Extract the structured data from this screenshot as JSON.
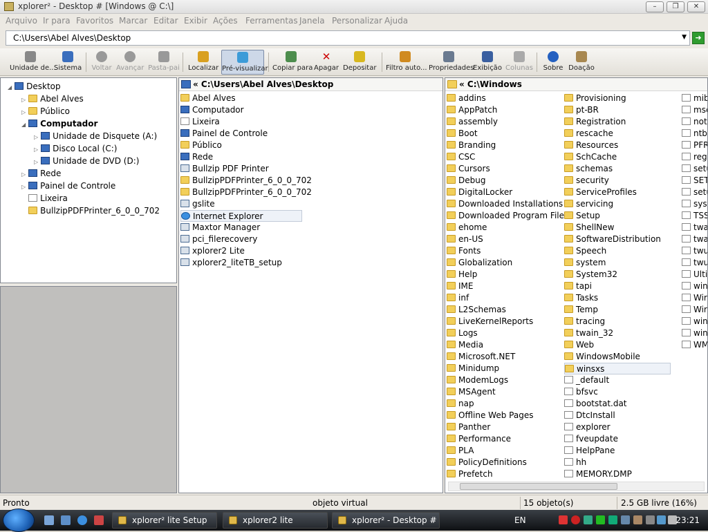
{
  "window": {
    "title": "xplorer² - Desktop # [Windows @ C:\\]"
  },
  "menu": [
    "Arquivo",
    "Ir para",
    "Favoritos",
    "Marcar",
    "Editar",
    "Exibir",
    "Ações",
    "Ferramentas",
    "Janela",
    "Personalizar",
    "Ajuda"
  ],
  "address": {
    "value": "C:\\Users\\Abel Alves\\Desktop"
  },
  "toolbar": [
    {
      "label": "Unidade de...",
      "icon": "drive-icon",
      "enabled": true
    },
    {
      "label": "Sistema",
      "icon": "system-icon",
      "enabled": true
    },
    {
      "label": "Voltar",
      "icon": "back-icon",
      "enabled": false
    },
    {
      "label": "Avançar",
      "icon": "forward-icon",
      "enabled": false
    },
    {
      "label": "Pasta-pai",
      "icon": "parent-folder-icon",
      "enabled": false
    },
    {
      "label": "Localizar",
      "icon": "binoculars-icon",
      "enabled": true
    },
    {
      "label": "Pré-visualizar",
      "icon": "preview-icon",
      "enabled": true,
      "pressed": true
    },
    {
      "label": "Copiar para",
      "icon": "copy-icon",
      "enabled": true
    },
    {
      "label": "Apagar",
      "icon": "delete-icon",
      "enabled": true
    },
    {
      "label": "Depositar",
      "icon": "deposit-icon",
      "enabled": true
    },
    {
      "label": "Filtro auto...",
      "icon": "filter-icon",
      "enabled": true
    },
    {
      "label": "Propriedades",
      "icon": "properties-icon",
      "enabled": true
    },
    {
      "label": "Exibição",
      "icon": "view-icon",
      "enabled": true
    },
    {
      "label": "Colunas",
      "icon": "columns-icon",
      "enabled": false
    },
    {
      "label": "Sobre",
      "icon": "help-icon",
      "enabled": true
    },
    {
      "label": "Doação",
      "icon": "donate-icon",
      "enabled": true
    }
  ],
  "tree": [
    {
      "label": "Desktop",
      "level": 0,
      "icon": "desktop-icon"
    },
    {
      "label": "Abel Alves",
      "level": 1,
      "icon": "user-folder-icon"
    },
    {
      "label": "Público",
      "level": 1,
      "icon": "folder-icon"
    },
    {
      "label": "Computador",
      "level": 1,
      "icon": "computer-icon",
      "bold": true
    },
    {
      "label": "Unidade de Disquete (A:)",
      "level": 2,
      "icon": "floppy-icon"
    },
    {
      "label": "Disco Local (C:)",
      "level": 2,
      "icon": "disk-icon"
    },
    {
      "label": "Unidade de DVD (D:)",
      "level": 2,
      "icon": "dvd-icon"
    },
    {
      "label": "Rede",
      "level": 1,
      "icon": "network-icon"
    },
    {
      "label": "Painel de Controle",
      "level": 1,
      "icon": "control-panel-icon"
    },
    {
      "label": "Lixeira",
      "level": 1,
      "icon": "recycle-bin-icon"
    },
    {
      "label": "BullzipPDFPrinter_6_0_0_702",
      "level": 1,
      "icon": "folder-icon"
    }
  ],
  "left_pane": {
    "header": "« C:\\Users\\Abel Alves\\Desktop",
    "items": [
      {
        "name": "Abel Alves",
        "icon": "user-folder-icon"
      },
      {
        "name": "Computador",
        "icon": "computer-icon"
      },
      {
        "name": "Lixeira",
        "icon": "recycle-bin-icon"
      },
      {
        "name": "Painel de Controle",
        "icon": "control-panel-icon"
      },
      {
        "name": "Público",
        "icon": "folder-icon"
      },
      {
        "name": "Rede",
        "icon": "network-icon"
      },
      {
        "name": "Bullzip PDF Printer",
        "icon": "printer-icon"
      },
      {
        "name": "BullzipPDFPrinter_6_0_0_702",
        "icon": "folder-icon"
      },
      {
        "name": "BullzipPDFPrinter_6_0_0_702",
        "icon": "folder-icon"
      },
      {
        "name": "gslite",
        "icon": "gs-icon"
      },
      {
        "name": "Internet Explorer",
        "icon": "ie-icon",
        "selected": true
      },
      {
        "name": "Maxtor Manager",
        "icon": "maxtor-icon"
      },
      {
        "name": "pci_filerecovery",
        "icon": "app-icon"
      },
      {
        "name": "xplorer2 Lite",
        "icon": "app-icon"
      },
      {
        "name": "xplorer2_liteTB_setup",
        "icon": "setup-icon"
      }
    ]
  },
  "right_pane": {
    "header": "« C:\\Windows",
    "col1": [
      "addins",
      "AppPatch",
      "assembly",
      "Boot",
      "Branding",
      "CSC",
      "Cursors",
      "Debug",
      "DigitalLocker",
      "Downloaded Installations",
      "Downloaded Program Files",
      "ehome",
      "en-US",
      "Fonts",
      "Globalization",
      "Help",
      "IME",
      "inf",
      "L2Schemas",
      "LiveKernelReports",
      "Logs",
      "Media",
      "Microsoft.NET",
      "Minidump",
      "ModemLogs",
      "MSAgent",
      "nap",
      "Offline Web Pages",
      "Panther",
      "Performance",
      "PLA",
      "PolicyDefinitions",
      "Prefetch"
    ],
    "col2": [
      "Provisioning",
      "pt-BR",
      "Registration",
      "rescache",
      "Resources",
      "SchCache",
      "schemas",
      "security",
      "ServiceProfiles",
      "servicing",
      "Setup",
      "ShellNew",
      "SoftwareDistribution",
      "Speech",
      "system",
      "System32",
      "tapi",
      "Tasks",
      "Temp",
      "tracing",
      "twain_32",
      "Web",
      "WindowsMobile",
      "winsxs",
      "_default",
      "bfsvc",
      "bootstat.dat",
      "DtcInstall",
      "explorer",
      "fveupdate",
      "HelpPane",
      "hh",
      "MEMORY.DMP"
    ],
    "col2_file_start": 24,
    "col2_selected": "winsxs",
    "col3": [
      "mib",
      "msc",
      "not",
      "ntb",
      "PFR",
      "reg",
      "setu",
      "SET",
      "setu",
      "syst",
      "TSS",
      "twa",
      "twa",
      "twu",
      "twu",
      "Ulti",
      "win",
      "Wir",
      "Wir",
      "win",
      "win",
      "WM"
    ]
  },
  "status": {
    "left": "Pronto",
    "middle": "objeto virtual",
    "count": "15 objeto(s)",
    "free": "2.5 GB livre (16%)"
  },
  "taskbar": {
    "buttons": [
      "xplorer² lite Setup",
      "xplorer2 lite",
      "xplorer² - Desktop # ..."
    ],
    "lang": "EN",
    "clock": "23:21"
  }
}
